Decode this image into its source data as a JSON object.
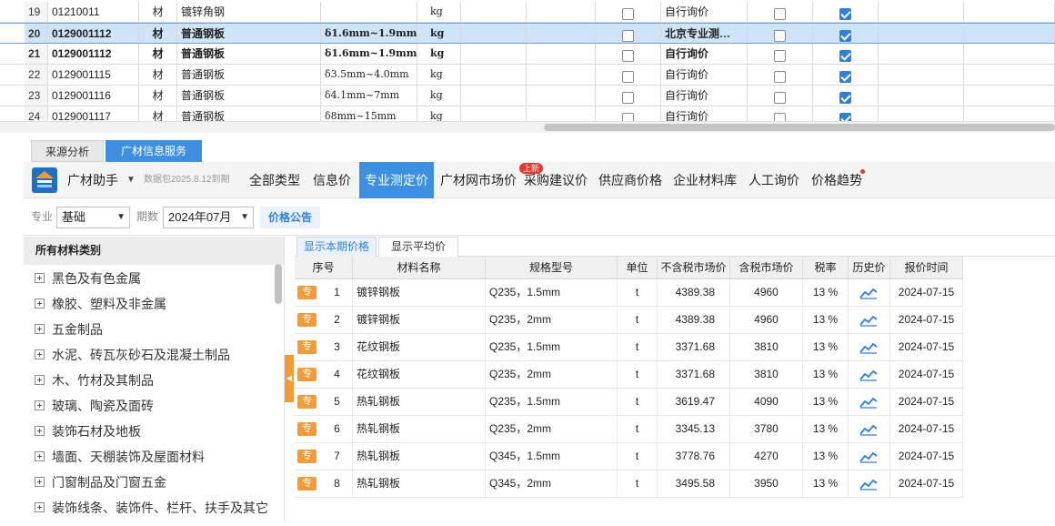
{
  "top_grid": {
    "rows": [
      {
        "num": "19",
        "code": "01210011",
        "type": "材",
        "name": "镀锌角钢",
        "spec": "",
        "unit": "kg",
        "c1": false,
        "source": "自行询价",
        "c2": false,
        "c3": true,
        "selected": false,
        "bold": false
      },
      {
        "num": "20",
        "code": "0129001112",
        "type": "材",
        "name": "普通钢板",
        "spec": "δ1.6mm~1.9mm",
        "unit": "kg",
        "c1": false,
        "source": "北京专业测…",
        "c2": false,
        "c3": true,
        "selected": true,
        "bold": true
      },
      {
        "num": "21",
        "code": "0129001112",
        "type": "材",
        "name": "普通钢板",
        "spec": "δ1.6mm~1.9mm",
        "unit": "kg",
        "c1": false,
        "source": "自行询价",
        "c2": false,
        "c3": true,
        "selected": false,
        "bold": true
      },
      {
        "num": "22",
        "code": "0129001115",
        "type": "材",
        "name": "普通钢板",
        "spec": "δ3.5mm~4.0mm",
        "unit": "kg",
        "c1": false,
        "source": "自行询价",
        "c2": false,
        "c3": true,
        "selected": false,
        "bold": false
      },
      {
        "num": "23",
        "code": "0129001116",
        "type": "材",
        "name": "普通钢板",
        "spec": "δ4.1mm~7mm",
        "unit": "kg",
        "c1": false,
        "source": "自行询价",
        "c2": false,
        "c3": true,
        "selected": false,
        "bold": false
      },
      {
        "num": "24",
        "code": "0129001117",
        "type": "材",
        "name": "普通钢板",
        "spec": "δ8mm~15mm",
        "unit": "kg",
        "c1": false,
        "source": "自行询价",
        "c2": false,
        "c3": true,
        "selected": false,
        "bold": false
      }
    ]
  },
  "panel_tabs": {
    "source_analysis": "来源分析",
    "info_service": "广材信息服务"
  },
  "toolbar": {
    "assistant": "广材助手",
    "caret": "▼",
    "package_date": "数据包2025.8.12到期",
    "nav": {
      "all_types": "全部类型",
      "info_price": "信息价",
      "pro_price": "专业测定价",
      "market_price": "广材网市场价",
      "purchase_price": "采购建议价",
      "supplier_price": "供应商价格",
      "enterprise_lib": "企业材料库",
      "manual_inquiry": "人工询价",
      "price_trend": "价格趋势"
    },
    "new_badge": "上新"
  },
  "filters": {
    "major_label": "专业",
    "major_value": "基础",
    "period_label": "期数",
    "period_value": "2024年07月",
    "notice": "价格公告"
  },
  "categories": {
    "title": "所有材料类别",
    "items": [
      "黑色及有色金属",
      "橡胶、塑料及非金属",
      "五金制品",
      "水泥、砖瓦灰砂石及混凝土制品",
      "木、竹材及其制品",
      "玻璃、陶瓷及面砖",
      "装饰石材及地板",
      "墙面、天棚装饰及屋面材料",
      "门窗制品及门窗五金",
      "装饰线条、装饰件、栏杆、扶手及其它"
    ]
  },
  "price_table": {
    "tabs": {
      "current": "显示本期价格",
      "average": "显示平均价"
    },
    "headers": {
      "no": "序号",
      "name": "材料名称",
      "spec": "规格型号",
      "unit": "单位",
      "excl_tax": "不含税市场价",
      "incl_tax": "含税市场价",
      "tax": "税率",
      "history": "历史价",
      "date": "报价时间"
    },
    "tag_label": "专",
    "rows": [
      {
        "no": "1",
        "name": "镀锌钢板",
        "spec": "Q235，1.5mm",
        "unit": "t",
        "excl": "4389.38",
        "incl": "4960",
        "tax": "13 %",
        "date": "2024-07-15"
      },
      {
        "no": "2",
        "name": "镀锌钢板",
        "spec": "Q235，2mm",
        "unit": "t",
        "excl": "4389.38",
        "incl": "4960",
        "tax": "13 %",
        "date": "2024-07-15"
      },
      {
        "no": "3",
        "name": "花纹钢板",
        "spec": "Q235，1.5mm",
        "unit": "t",
        "excl": "3371.68",
        "incl": "3810",
        "tax": "13 %",
        "date": "2024-07-15"
      },
      {
        "no": "4",
        "name": "花纹钢板",
        "spec": "Q235，2mm",
        "unit": "t",
        "excl": "3371.68",
        "incl": "3810",
        "tax": "13 %",
        "date": "2024-07-15"
      },
      {
        "no": "5",
        "name": "热轧钢板",
        "spec": "Q235，1.5mm",
        "unit": "t",
        "excl": "3619.47",
        "incl": "4090",
        "tax": "13 %",
        "date": "2024-07-15"
      },
      {
        "no": "6",
        "name": "热轧钢板",
        "spec": "Q235，2mm",
        "unit": "t",
        "excl": "3345.13",
        "incl": "3780",
        "tax": "13 %",
        "date": "2024-07-15"
      },
      {
        "no": "7",
        "name": "热轧钢板",
        "spec": "Q345，1.5mm",
        "unit": "t",
        "excl": "3778.76",
        "incl": "4270",
        "tax": "13 %",
        "date": "2024-07-15"
      },
      {
        "no": "8",
        "name": "热轧钢板",
        "spec": "Q345，2mm",
        "unit": "t",
        "excl": "3495.58",
        "incl": "3950",
        "tax": "13 %",
        "date": "2024-07-15"
      }
    ]
  },
  "colors": {
    "accent": "#3d8fe2",
    "tag_orange": "#f39b36",
    "badge_red": "#e23a2f",
    "selected_row": "#cfe3fb"
  },
  "icons": {
    "logo": "guangcai-logo-icon",
    "trend": "trend-line-icon",
    "expand": "plus-box-icon",
    "checkbox": "checkbox-icon"
  }
}
